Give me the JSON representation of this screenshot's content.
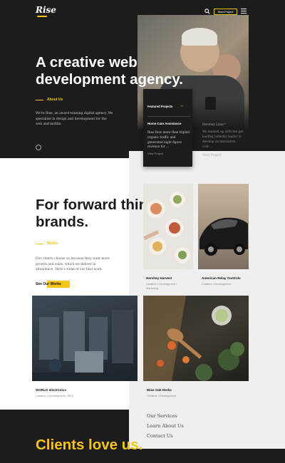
{
  "header": {
    "logo": "Rise",
    "start_label": "Start Project"
  },
  "hero": {
    "title": "A creative web development agency.",
    "about_label": "About Us",
    "description": "We're Rise, an award-winning digital agency. We specialize in design and development for the web and mobile."
  },
  "featured": {
    "label": "Featured Projects",
    "title": "Home Care Assistance",
    "description": "Rise How more than tripled organic traffic and generated eight figure revenue for ...",
    "view_label": "View Project",
    "side_title": "Hershey Linia™",
    "side_desc": "We teamed up with the get leading industry leader to develop an innovative, cost-...",
    "side_view": "View Project"
  },
  "brands": {
    "title": "For forward thinking brands.",
    "works_label": "Works",
    "description": "Our clients choose us because they want more growth and sales, which we deliver in abundance. Here's some of our best work.",
    "see_works": "See Our Works"
  },
  "works": [
    {
      "title": "Hershey Harvest",
      "sub": "Creative • Development • Marketing"
    },
    {
      "title": "American Relay Controls",
      "sub": "Creative • Development"
    },
    {
      "title": "WORLD electronics",
      "sub": "Creative • Development • SEO"
    },
    {
      "title": "Wise Oak Herbs",
      "sub": "Creative • Development"
    }
  ],
  "footer": {
    "links": [
      "Our Services",
      "Learn About Us",
      "Contact Us"
    ]
  },
  "clients": {
    "title": "Clients love us."
  },
  "colors": {
    "accent": "#f5c518",
    "dark": "#1c1c1c",
    "light": "#efefef"
  }
}
